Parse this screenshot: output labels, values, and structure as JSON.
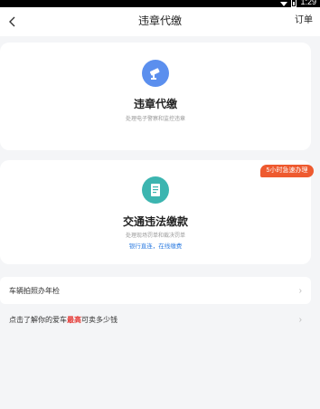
{
  "status_bar": {
    "time": "1:29"
  },
  "header": {
    "title": "违章代缴",
    "orders_label": "订单"
  },
  "cards": [
    {
      "title": "违章代缴",
      "subtitle": "处理电子警察和监控违章",
      "accent": "#5b8fee"
    },
    {
      "title": "交通违法缴款",
      "subtitle": "处理现场罚单和裁决罚单",
      "links": "银行直连，在线缴费",
      "badge": "5小时急速办理",
      "accent": "#3cb5b0"
    }
  ],
  "rows": [
    {
      "label": "车辆拍照办年检"
    },
    {
      "label_prefix": "点击了解你的爱车",
      "label_highlight": "最高",
      "label_suffix": "可卖多少钱"
    }
  ],
  "colors": {
    "background": "#f4f5f7",
    "badge": "#ee5a2f",
    "link": "#2f7de1",
    "highlight": "#e53935"
  }
}
